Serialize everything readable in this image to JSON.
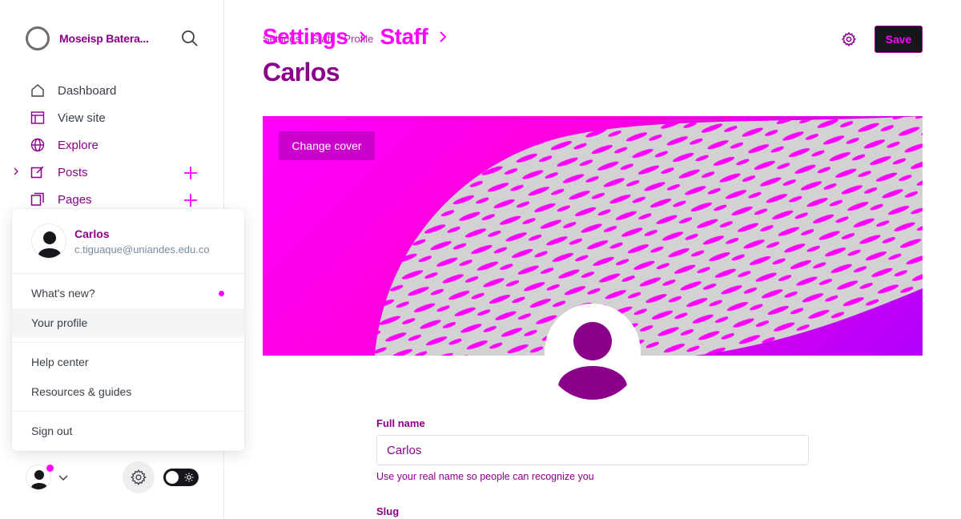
{
  "brand": {
    "name": "Moseisp Batera..."
  },
  "nav": {
    "items": [
      {
        "label": "Dashboard",
        "icon": "home-icon"
      },
      {
        "label": "View site",
        "icon": "browser-icon"
      },
      {
        "label": "Explore",
        "icon": "globe-icon"
      },
      {
        "label": "Posts",
        "icon": "pencil-square-icon"
      },
      {
        "label": "Pages",
        "icon": "pages-icon"
      }
    ]
  },
  "menu": {
    "user_name": "Carlos",
    "user_email": "c.tiguaque@uniandes.edu.co",
    "items": [
      "What's new?",
      "Your profile",
      "Help center",
      "Resources & guides",
      "Sign out"
    ]
  },
  "header": {
    "breadcrumb_big": [
      "Settings",
      "Staff"
    ],
    "breadcrumb_small": [
      "Settings",
      "Staff",
      "Profile"
    ],
    "title": "Carlos",
    "save_label": "Save"
  },
  "cover": {
    "change_label": "Change cover"
  },
  "form": {
    "full_name_label": "Full name",
    "full_name_value": "Carlos",
    "full_name_hint": "Use your real name so people can recognize you",
    "slug_label": "Slug"
  },
  "colors": {
    "accent": "#ff00ff",
    "accent_dark": "#8b008b",
    "dark": "#15171a"
  }
}
